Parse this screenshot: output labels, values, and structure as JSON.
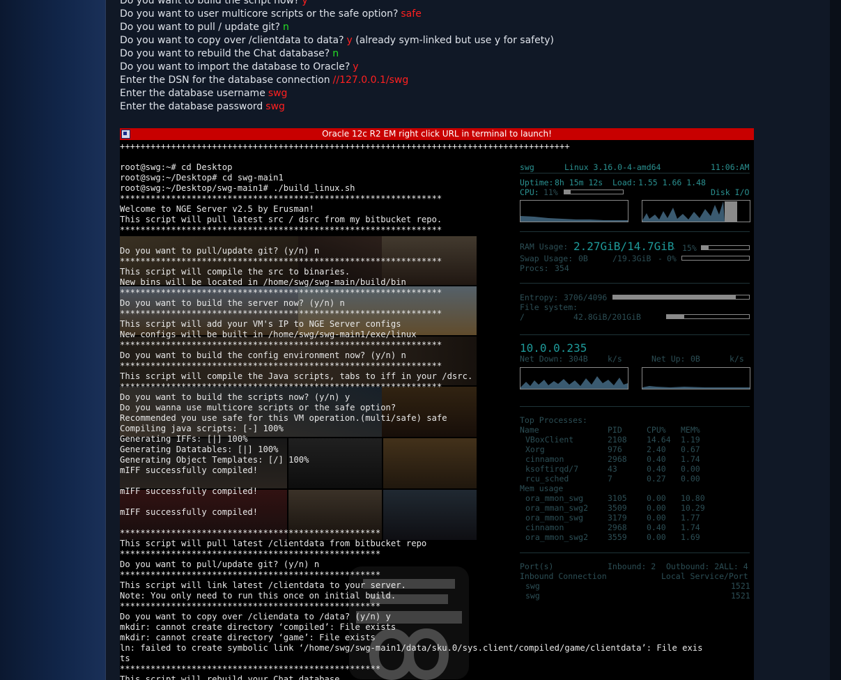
{
  "questions": [
    {
      "q": "Do you want to build the script now?",
      "a": "y",
      "color": "#ff2020",
      "suffix": ""
    },
    {
      "q": "Do you want to user multicore scripts or the safe option?",
      "a": "safe",
      "color": "#ff2020",
      "suffix": ""
    },
    {
      "q": "Do you want to pull / update git?",
      "a": "n",
      "color": "#25e025",
      "suffix": ""
    },
    {
      "q": "Do you want to copy over /clientdata to data?",
      "a": "y",
      "color": "#ff2020",
      "suffix": " (already sym-linked but use y for safety)"
    },
    {
      "q": "Do you want to rebuild the Chat database?",
      "a": "n",
      "color": "#25e025",
      "suffix": ""
    },
    {
      "q": "Do you want to import the database to Oracle?",
      "a": "y",
      "color": "#ff2020",
      "suffix": ""
    },
    {
      "q": "Enter the DSN for the database connection",
      "a": "//127.0.0.1/swg",
      "color": "#ff2020",
      "suffix": ""
    },
    {
      "q": "Enter the database username",
      "a": "swg",
      "color": "#ff2020",
      "suffix": ""
    },
    {
      "q": "Enter the database password",
      "a": "swg",
      "color": "#ff2020",
      "suffix": ""
    }
  ],
  "window": {
    "title": "Oracle 12c R2 EM right click URL in terminal to launch!",
    "title_color": "#c80000"
  },
  "terminal": {
    "lines": [
      "++++++++++++++++++++++++++++++++++++++++++++++++++++++++++++++++++++++++++++++++++++++++",
      "",
      "root@swg:~# cd Desktop",
      "root@swg:~/Desktop# cd swg-main1",
      "root@swg:~/Desktop/swg-main1# ./build_linux.sh",
      "***************************************************************",
      "Welcome to NGE Server v2.5 by Erusman!",
      "This script will pull latest src / dsrc from my bitbucket repo.",
      "***************************************************************",
      "",
      "Do you want to pull/update git? (y/n) n",
      "***************************************************************",
      "This script will compile the src to binaries.",
      "New bins will be located in /home/swg/swg-main/build/bin",
      "***************************************************************",
      "Do you want to build the server now? (y/n) n",
      "***************************************************************",
      "This script will add your VM's IP to NGE Server configs",
      "New configs will be built in /home/swg/swg-main1/exe/linux",
      "***************************************************************",
      "Do you want to build the config environment now? (y/n) n",
      "***************************************************************",
      "This script will compile the Java scripts, tabs to iff in your /dsrc.",
      "***************************************************************",
      "Do you want to build the scripts now? (y/n) y",
      "Do you wanna use multicore scripts or the safe option?",
      "Recommended you use safe for this VM operation.(multi/safe) safe",
      "Compiling java scripts: [-] 100%",
      "Generating IFFs: [|] 100%",
      "Generating Datatables: [|] 100%",
      "Generating Object Templates: [/] 100%",
      "mIFF successfully compiled!",
      "",
      "mIFF successfully compiled!",
      "",
      "mIFF successfully compiled!",
      "",
      "***************************************************",
      "This script will pull latest /clientdata from bitbucket repo",
      "***************************************************",
      "Do you want to pull/update git? (y/n) n",
      "***************************************************",
      "This script will link latest /clientdata to your server.",
      "Note: You only need to run this once on initial build.",
      "***************************************************",
      "Do you want to copy over /cliendata to /data? (y/n) y",
      "mkdir: cannot create directory ‘compiled’: File exists",
      "mkdir: cannot create directory ‘game’: File exists",
      "ln: failed to create symbolic link ‘/home/swg/swg-main1/data/sku.0/sys.client/compiled/game/clientdata’: File exis",
      "ts",
      "***************************************************",
      "This script will rebuild your Chat database",
      "***************************************************"
    ]
  },
  "conky": {
    "host": "swg",
    "kernel": "Linux 3.16.0-4-amd64",
    "time": "11:06:AM",
    "uptime_label": "Uptime:",
    "uptime": "8h 15m 12s",
    "load_label": "Load:",
    "load": "1.55 1.66 1.48",
    "cpu_label": "CPU:",
    "cpu": "11%",
    "cpu_fraction": 0.11,
    "disk_io_label": "Disk I/O",
    "ram_label": "RAM Usage:",
    "ram": "2.27GiB/14.7GiB",
    "ram_sep": "-",
    "ram_pct": "15%",
    "ram_fraction": 0.15,
    "swap_label": "Swap Usage:",
    "swap_used": "0B",
    "swap_total": "/19.3GiB",
    "swap_sep": "-",
    "swap_pct": "0%",
    "swap_fraction": 0.0,
    "procs_label": "Procs:",
    "procs": "354",
    "entropy_label": "Entropy:",
    "entropy": "3706/4096",
    "entropy_fraction": 0.905,
    "fs_label": "File system:",
    "fs_mount": "/",
    "fs_usage": "42.8GiB/201GiB",
    "fs_fraction": 0.21,
    "ip": "10.0.0.235",
    "net_down_label": "Net Down:",
    "net_down": "304B",
    "net_down_unit": "k/s",
    "net_up_label": "Net Up:",
    "net_up": "0B",
    "net_up_unit": "k/s",
    "top_label": "Top Processes:",
    "proc_headers": [
      "Name",
      "PID",
      "CPU%",
      "MEM%"
    ],
    "top_processes": [
      [
        "VBoxClient",
        "2108",
        "14.64",
        "1.19"
      ],
      [
        "Xorg",
        "976",
        "2.40",
        "0.67"
      ],
      [
        "cinnamon",
        "2968",
        "0.40",
        "1.74"
      ],
      [
        "ksoftirqd/7",
        "43",
        "0.40",
        "0.00"
      ],
      [
        "rcu_sched",
        "7",
        "0.27",
        "0.00"
      ]
    ],
    "mem_label": "Mem usage",
    "mem_processes": [
      [
        "ora_mmon_swg",
        "3105",
        "0.00",
        "10.80"
      ],
      [
        "ora_mman_swg2",
        "3509",
        "0.00",
        "10.29"
      ],
      [
        "ora_mmon_swg",
        "3179",
        "0.00",
        "1.77"
      ],
      [
        "cinnamon",
        "2968",
        "0.40",
        "1.74"
      ],
      [
        "ora_mmon_swg2",
        "3559",
        "0.00",
        "1.69"
      ]
    ],
    "ports_label": "Port(s)",
    "inbound_label": "Inbound: 2",
    "outbound_label": "Outbound: 2ALL: 4",
    "inbound_conn_label": "Inbound Connection",
    "local_service_label": "Local Service/Port",
    "ports": [
      [
        "swg",
        "1521"
      ],
      [
        "swg",
        "1521"
      ]
    ]
  }
}
